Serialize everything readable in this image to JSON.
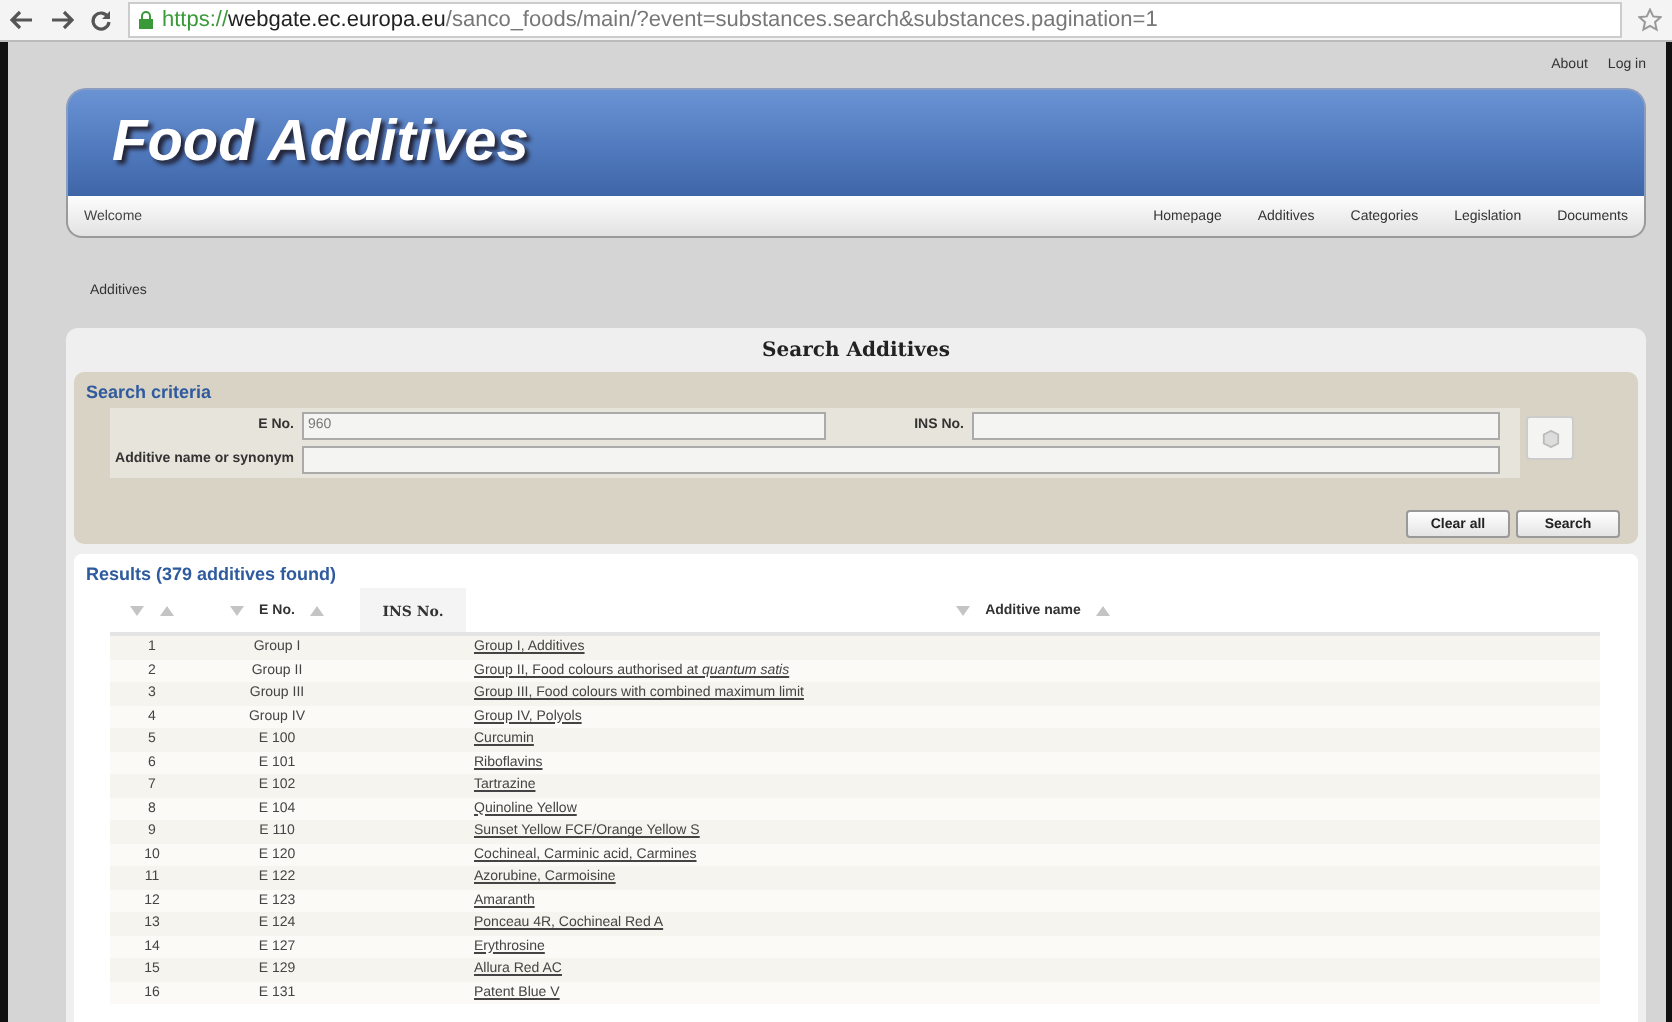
{
  "browser": {
    "url": {
      "scheme": "https://",
      "host": "webgate.ec.europa.eu",
      "path": "/sanco_foods/main/?event=substances.search&substances.pagination=1"
    }
  },
  "top_links": [
    "About",
    "Log in"
  ],
  "banner": {
    "title": "Food Additives"
  },
  "nav": {
    "welcome": "Welcome",
    "items": [
      "Homepage",
      "Additives",
      "Categories",
      "Legislation",
      "Documents"
    ]
  },
  "breadcrumb": "Additives",
  "page_title": "Search Additives",
  "search": {
    "title": "Search criteria",
    "fields": [
      {
        "label": "E No.",
        "value": "960"
      },
      {
        "label": "INS No."
      },
      {
        "label": "Additive name or synonym"
      }
    ],
    "buttons": [
      "Clear all",
      "Search"
    ]
  },
  "results": {
    "title": "Results (379 additives found)",
    "columns": [
      {
        "sortable": true
      },
      {
        "label": "E No.",
        "sortable": true
      },
      {
        "label": "INS No.",
        "sortable": false
      },
      {
        "label": "Additive name",
        "sortable": true
      }
    ],
    "rows": [
      {
        "number": "1",
        "e_no": "Group I",
        "name": "Group I, Additives"
      },
      {
        "number": "2",
        "e_no": "Group II",
        "name": "Group II, Food colours authorised at *quantum satis*"
      },
      {
        "number": "3",
        "e_no": "Group III",
        "name": "Group III, Food colours with combined maximum limit"
      },
      {
        "number": "4",
        "e_no": "Group IV",
        "name": "Group IV, Polyols"
      },
      {
        "number": "5",
        "e_no": "E 100",
        "name": "Curcumin"
      },
      {
        "number": "6",
        "e_no": "E 101",
        "name": "Riboflavins"
      },
      {
        "number": "7",
        "e_no": "E 102",
        "name": "Tartrazine"
      },
      {
        "number": "8",
        "e_no": "E 104",
        "name": "Quinoline Yellow"
      },
      {
        "number": "9",
        "e_no": "E 110",
        "name": "Sunset Yellow FCF/Orange Yellow S"
      },
      {
        "number": "10",
        "e_no": "E 120",
        "name": "Cochineal, Carminic acid, Carmines"
      },
      {
        "number": "11",
        "e_no": "E 122",
        "name": "Azorubine, Carmoisine"
      },
      {
        "number": "12",
        "e_no": "E 123",
        "name": "Amaranth"
      },
      {
        "number": "13",
        "e_no": "E 124",
        "name": "Ponceau 4R, Cochineal Red A"
      },
      {
        "number": "14",
        "e_no": "E 127",
        "name": "Erythrosine"
      },
      {
        "number": "15",
        "e_no": "E 129",
        "name": "Allura Red AC"
      },
      {
        "number": "16",
        "e_no": "E 131",
        "name": "Patent Blue V"
      }
    ]
  }
}
